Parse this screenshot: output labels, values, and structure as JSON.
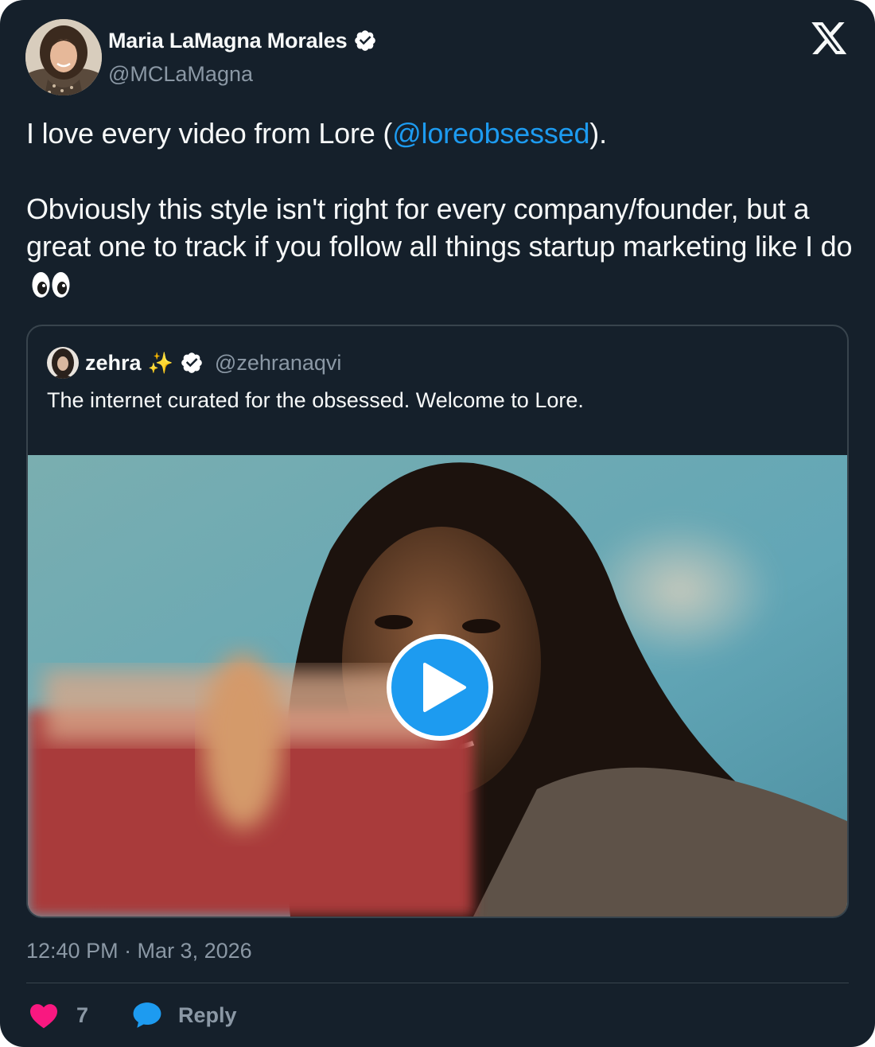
{
  "author": {
    "display_name": "Maria LaMagna Morales",
    "handle": "@MCLaMagna",
    "verified": true
  },
  "tweet": {
    "line1_before": "I love every video from Lore (",
    "mention": "@loreobsessed",
    "line1_after": ").",
    "paragraph2": "Obviously this style isn't right for every company/founder, but a great one to track if you follow all things startup marketing like I do",
    "emoji": "eyes-emoji"
  },
  "quote": {
    "display_name": "zehra",
    "sparkles": "✨",
    "handle": "@zehranaqvi",
    "verified": true,
    "text": "The internet curated for the obsessed. Welcome to Lore.",
    "media": "video-thumbnail"
  },
  "footer": {
    "timestamp": "12:40 PM · Mar 3, 2026",
    "like_count": "7",
    "reply_label": "Reply"
  },
  "colors": {
    "background": "#15202b",
    "text": "#f7f9f9",
    "secondary": "#8b98a5",
    "accent": "#1d9bf0",
    "like": "#f91880",
    "border": "#38444d"
  }
}
